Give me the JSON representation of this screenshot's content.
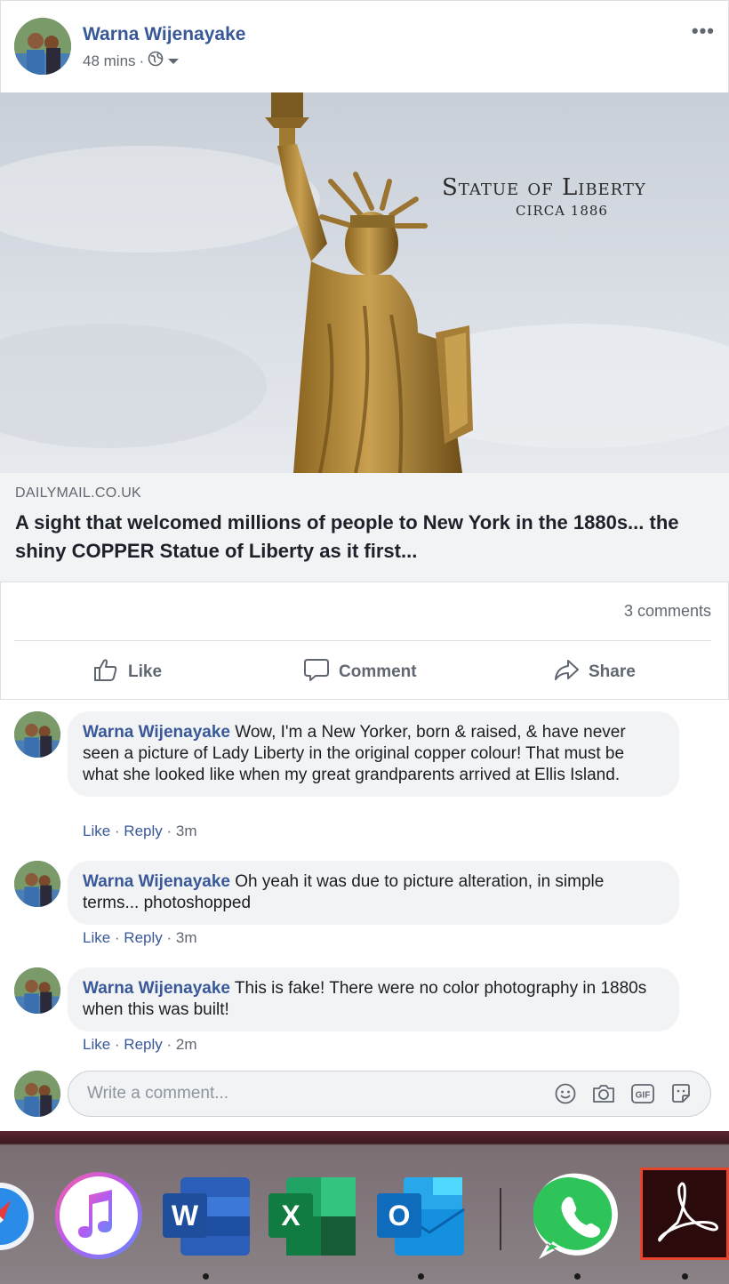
{
  "post": {
    "author": "Warna Wijenayake",
    "time": "48 mins",
    "separator": "·",
    "more_label": "•••",
    "photo_title": "Statue of Liberty",
    "photo_subtitle": "CIRCA 1886",
    "link_domain": "DAILYMAIL.CO.UK",
    "link_title": "A sight that welcomed millions of people to New York in the 1880s... the shiny COPPER Statue of Liberty as it first...",
    "comment_count": "3 comments",
    "actions": {
      "like": "Like",
      "comment": "Comment",
      "share": "Share"
    }
  },
  "comments": [
    {
      "author": "Warna Wijenayake",
      "text": "Wow, I'm a New Yorker, born & raised, & have never seen a picture of Lady Liberty in the original copper colour! That must be what she looked like when my great grandparents arrived at Ellis Island.",
      "like": "Like",
      "reply": "Reply",
      "time": "3m"
    },
    {
      "author": "Warna Wijenayake",
      "text": "Oh yeah it was due to picture alteration, in simple terms... photoshopped",
      "like": "Like",
      "reply": "Reply",
      "time": "3m"
    },
    {
      "author": "Warna Wijenayake",
      "text": "This is fake! There were no color photography in 1880s when this was built!",
      "like": "Like",
      "reply": "Reply",
      "time": "2m"
    }
  ],
  "composer": {
    "placeholder": "Write a comment...",
    "gif_label": "GIF"
  },
  "dock": {
    "apps": [
      "safari-icon",
      "itunes-icon",
      "word-icon",
      "excel-icon",
      "outlook-icon",
      "whatsapp-icon",
      "acrobat-icon"
    ],
    "word_letter": "W",
    "excel_letter": "X",
    "outlook_letter": "O"
  },
  "colors": {
    "link_blue": "#385898",
    "meta_gray": "#606770",
    "bubble_bg": "#f2f3f5"
  }
}
